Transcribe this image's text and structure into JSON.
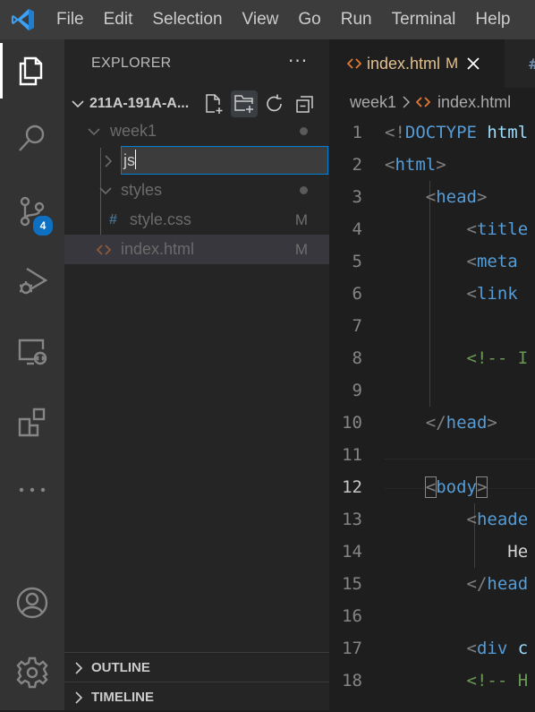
{
  "menu": {
    "items": [
      "File",
      "Edit",
      "Selection",
      "View",
      "Go",
      "Run",
      "Terminal",
      "Help"
    ]
  },
  "activity": {
    "items": [
      {
        "name": "explorer-icon",
        "active": true
      },
      {
        "name": "search-icon",
        "active": false
      },
      {
        "name": "source-control-icon",
        "active": false,
        "badge": "4"
      },
      {
        "name": "run-debug-icon",
        "active": false
      },
      {
        "name": "remote-explorer-icon",
        "active": false
      },
      {
        "name": "extensions-icon",
        "active": false
      },
      {
        "name": "more-icon",
        "active": false
      }
    ],
    "bottom": [
      {
        "name": "account-icon"
      },
      {
        "name": "settings-gear-icon"
      }
    ]
  },
  "sidebar": {
    "title": "EXPLORER",
    "more": "···",
    "folder": "211A-191A-A...",
    "tree": {
      "week1": "week1",
      "rename_value": "js",
      "styles": "styles",
      "style_css_icon": "#",
      "style_css": "style.css",
      "style_css_status": "M",
      "index_html": "index.html",
      "index_html_status": "M"
    },
    "outline": "OUTLINE",
    "timeline": "TIMELINE"
  },
  "editor": {
    "tab": {
      "name": "index.html",
      "status": "M"
    },
    "breadcrumb": {
      "folder": "week1",
      "file": "index.html"
    },
    "lines": [
      {
        "n": "1",
        "parts": [
          [
            "punc",
            "<!"
          ],
          [
            "tag",
            "DOCTYPE"
          ],
          [
            "plain",
            " "
          ],
          [
            "attr",
            "html"
          ]
        ]
      },
      {
        "n": "2",
        "parts": [
          [
            "punc",
            "<"
          ],
          [
            "tag",
            "html"
          ],
          [
            "punc",
            ">"
          ]
        ]
      },
      {
        "n": "3",
        "parts": [
          [
            "plain",
            "    "
          ],
          [
            "punc",
            "<"
          ],
          [
            "tag",
            "head"
          ],
          [
            "punc",
            ">"
          ]
        ]
      },
      {
        "n": "4",
        "parts": [
          [
            "plain",
            "        "
          ],
          [
            "punc",
            "<"
          ],
          [
            "tag",
            "title"
          ]
        ]
      },
      {
        "n": "5",
        "parts": [
          [
            "plain",
            "        "
          ],
          [
            "punc",
            "<"
          ],
          [
            "tag",
            "meta"
          ]
        ]
      },
      {
        "n": "6",
        "parts": [
          [
            "plain",
            "        "
          ],
          [
            "punc",
            "<"
          ],
          [
            "tag",
            "link"
          ]
        ]
      },
      {
        "n": "7",
        "parts": []
      },
      {
        "n": "8",
        "parts": [
          [
            "plain",
            "        "
          ],
          [
            "cmt",
            "<!-- I"
          ]
        ]
      },
      {
        "n": "9",
        "parts": []
      },
      {
        "n": "10",
        "parts": [
          [
            "plain",
            "    "
          ],
          [
            "punc",
            "</"
          ],
          [
            "tag",
            "head"
          ],
          [
            "punc",
            ">"
          ]
        ]
      },
      {
        "n": "11",
        "parts": []
      },
      {
        "n": "12",
        "parts": [
          [
            "plain",
            "    "
          ],
          [
            "punc",
            "<"
          ],
          [
            "tag",
            "body"
          ],
          [
            "punc",
            ">"
          ]
        ]
      },
      {
        "n": "13",
        "parts": [
          [
            "plain",
            "        "
          ],
          [
            "punc",
            "<"
          ],
          [
            "tag",
            "heade"
          ]
        ]
      },
      {
        "n": "14",
        "parts": [
          [
            "plain",
            "            "
          ],
          [
            "plain",
            "He"
          ]
        ]
      },
      {
        "n": "15",
        "parts": [
          [
            "plain",
            "        "
          ],
          [
            "punc",
            "</"
          ],
          [
            "tag",
            "head"
          ]
        ]
      },
      {
        "n": "16",
        "parts": []
      },
      {
        "n": "17",
        "parts": [
          [
            "plain",
            "        "
          ],
          [
            "punc",
            "<"
          ],
          [
            "tag",
            "div"
          ],
          [
            "plain",
            " "
          ],
          [
            "attr",
            "c"
          ]
        ]
      },
      {
        "n": "18",
        "parts": [
          [
            "plain",
            "        "
          ],
          [
            "cmt",
            "<!-- H"
          ]
        ]
      }
    ],
    "current_line": "12"
  }
}
